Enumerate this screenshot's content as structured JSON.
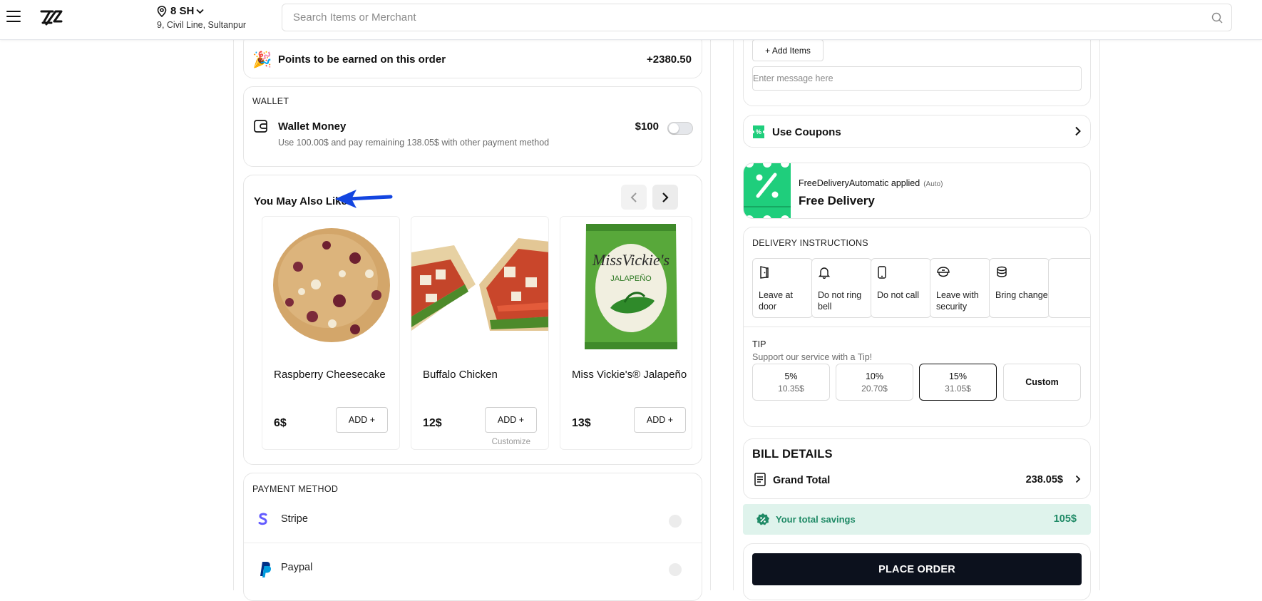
{
  "header": {
    "location_title": "8 SH",
    "location_address": "9, Civil Line, Sultanpur",
    "search_placeholder": "Search Items or Merchant"
  },
  "points": {
    "label": "Points to be earned on this order",
    "value": "+2380.50"
  },
  "wallet": {
    "section": "WALLET",
    "title": "Wallet Money",
    "subtitle": "Use 100.00$ and pay remaining 138.05$ with other payment method",
    "amount": "$100",
    "toggle_on": false
  },
  "also_like": {
    "title": "You May Also Like",
    "products": [
      {
        "name": "Raspberry Cheesecake",
        "price": "6$",
        "add": "ADD +",
        "customize": ""
      },
      {
        "name": "Buffalo Chicken",
        "price": "12$",
        "add": "ADD +",
        "customize": "Customize"
      },
      {
        "name": "Miss Vickie's® Jalapeño",
        "price": "13$",
        "add": "ADD +",
        "customize": ""
      }
    ],
    "chip_brand": "MissVickie's",
    "chip_flavor": "JALAPEÑO"
  },
  "payment": {
    "section": "PAYMENT METHOD",
    "methods": [
      {
        "label": "Stripe"
      },
      {
        "label": "Paypal"
      }
    ]
  },
  "cart": {
    "add_items": "+ Add Items",
    "message_placeholder": "Enter message here"
  },
  "coupons": {
    "label": "Use Coupons"
  },
  "free_delivery": {
    "applied": "FreeDeliveryAutomatic applied",
    "auto": "(Auto)",
    "title": "Free Delivery"
  },
  "delivery": {
    "section": "DELIVERY INSTRUCTIONS",
    "options": [
      {
        "label": "Leave at door",
        "icon": "door-icon"
      },
      {
        "label": "Do not ring bell",
        "icon": "bell-icon"
      },
      {
        "label": "Do not call",
        "icon": "phone-icon"
      },
      {
        "label": "Leave with security",
        "icon": "guard-icon"
      },
      {
        "label": "Bring change",
        "icon": "coins-icon"
      }
    ]
  },
  "tip": {
    "section": "TIP",
    "subtitle": "Support our service with a Tip!",
    "options": [
      {
        "percent": "5%",
        "amount": "10.35$"
      },
      {
        "percent": "10%",
        "amount": "20.70$"
      },
      {
        "percent": "15%",
        "amount": "31.05$",
        "selected": true
      }
    ],
    "custom": "Custom"
  },
  "bill": {
    "title": "BILL DETAILS",
    "grand_total_label": "Grand Total",
    "grand_total_value": "238.05$"
  },
  "savings": {
    "label": "Your total savings",
    "value": "105$"
  },
  "order": {
    "button": "PLACE ORDER"
  },
  "colors": {
    "accent_green": "#1fce7c",
    "savings_bg": "#dff3ec",
    "savings_text": "#1f8a66",
    "primary_dark": "#0c111d",
    "annotation_arrow": "#1345e0",
    "stripe": "#635bff",
    "paypal": "#003087"
  }
}
